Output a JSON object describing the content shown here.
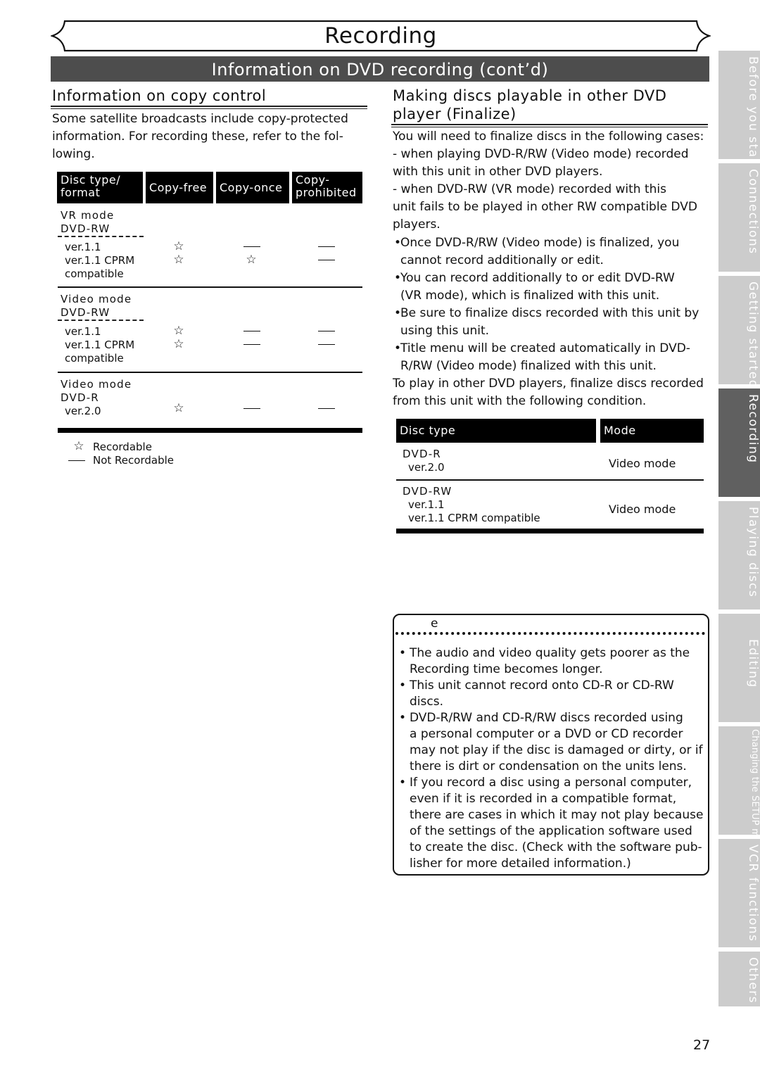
{
  "header": {
    "chapter_title": "Recording",
    "section_title": "Information on DVD recording (cont’d)"
  },
  "left": {
    "heading": "Information on copy control",
    "intro": "Some satellite broadcasts include copy-protected information. For recording these, refer to the following.",
    "intro_lines": [
      "Some satellite broadcasts include copy-protected",
      "information. For recording these, refer to the fol-",
      "lowing."
    ],
    "table": {
      "headers": {
        "disc_type_l1": "Disc type/",
        "disc_type_l2": "format",
        "copy_free": "Copy-free",
        "copy_once": "Copy-once",
        "copy_prohibited_l1": "Copy-",
        "copy_prohibited_l2": "prohibited"
      },
      "groups": [
        {
          "mode": "VR mode",
          "disc": "DVD-RW",
          "rows": [
            {
              "label": "ver.1.1",
              "copy_free": "☆",
              "copy_once": "—",
              "copy_prohibited": "—"
            },
            {
              "label": "ver.1.1 CPRM",
              "label2": "compatible",
              "copy_free": "☆",
              "copy_once": "☆",
              "copy_prohibited": "—"
            }
          ]
        },
        {
          "mode": "Video mode",
          "disc": "DVD-RW",
          "rows": [
            {
              "label": "ver.1.1",
              "copy_free": "☆",
              "copy_once": "—",
              "copy_prohibited": "—"
            },
            {
              "label": "ver.1.1 CPRM",
              "label2": "compatible",
              "copy_free": "☆",
              "copy_once": "—",
              "copy_prohibited": "—"
            }
          ]
        },
        {
          "mode": "Video mode",
          "disc": "DVD-R",
          "rows": [
            {
              "label": "ver.2.0",
              "copy_free": "☆",
              "copy_once": "—",
              "copy_prohibited": "—"
            }
          ]
        }
      ]
    },
    "legend": [
      {
        "symbol": "star-outline",
        "glyph": "☆",
        "label": "Recordable"
      },
      {
        "symbol": "dash",
        "glyph": "—",
        "label": "Not Recordable"
      }
    ]
  },
  "right": {
    "heading_l1": "Making discs playable in other DVD",
    "heading_l2": "player (Finalize)",
    "lines": [
      "You will need to finalize discs in the following cases:",
      "- when playing DVD-R/RW  (Video mode) recorded",
      "with this unit in other DVD players.",
      "- when DVD-RW  (VR mode) recorded with this",
      "unit fails to be played in other RW  compatible DVD",
      "players."
    ],
    "bullets": [
      [
        "Once DVD-R/RW  (Video mode) is finalized, you",
        "cannot record additionally or edit."
      ],
      [
        "You can record additionally to or edit DVD-RW",
        "(VR mode), which is finalized with this unit."
      ],
      [
        "Be sure to finalize discs recorded with this unit by",
        "using this unit."
      ],
      [
        "Title menu will be created automatically in DVD-",
        "R/RW  (Video mode) finalized with this unit."
      ]
    ],
    "outro": [
      "To play in other DVD players, finalize discs recorded",
      "from this unit with the following condition."
    ],
    "table": {
      "headers": {
        "disc_type": "Disc type",
        "mode": "Mode"
      },
      "rows": [
        {
          "disc": "DVD-R",
          "versions": [
            "ver.2.0"
          ],
          "mode": "Video mode"
        },
        {
          "disc": "DVD-RW",
          "versions": [
            "ver.1.1",
            "ver.1.1 CPRM compatible"
          ],
          "mode": "Video mode"
        }
      ]
    },
    "note": {
      "title_fragment": "e",
      "bullets": [
        [
          "The audio and video quality gets poorer as the",
          "Recording time becomes longer."
        ],
        [
          "This unit cannot record onto CD-R or CD-RW",
          "discs."
        ],
        [
          "DVD-R/RW  and CD-R/RW  discs recorded using",
          "a personal computer or a DVD or CD recorder",
          "may not play if the disc is damaged or dirty, or if",
          "there is dirt or condensation on the units lens."
        ],
        [
          "If you record a disc using a personal computer,",
          "even if it is recorded in a compatible format,",
          "there are cases in which it may not play because",
          "of the settings of the application software used",
          "to create the disc. (Check with the software pub-",
          "lisher for more detailed information.)"
        ]
      ]
    }
  },
  "sidebar": {
    "tabs": [
      {
        "label": "Before you start",
        "active": false
      },
      {
        "label": "Connections",
        "active": false
      },
      {
        "label": "Getting started",
        "active": false
      },
      {
        "label": "Recording",
        "active": true
      },
      {
        "label": "Playing discs",
        "active": false
      },
      {
        "label": "Editing",
        "active": false
      },
      {
        "label": "Changing the SETUP menu",
        "active": false
      },
      {
        "label": "VCR functions",
        "active": false
      },
      {
        "label": "Others",
        "active": false
      }
    ]
  },
  "footer": {
    "page_number": "27"
  },
  "colors": {
    "section_bar": "#4d4d4d",
    "tab_inactive": "#cccccc",
    "tab_active": "#606060",
    "table_header": "#000000"
  }
}
